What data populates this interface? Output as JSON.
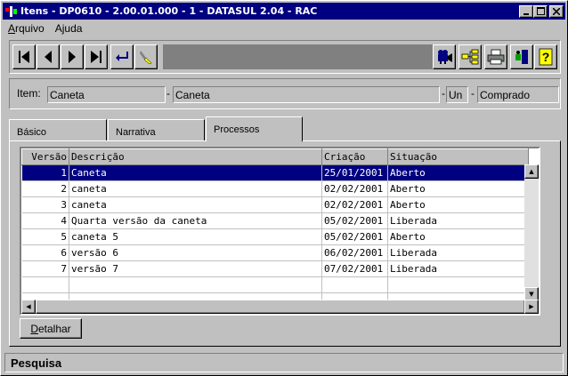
{
  "window": {
    "title": "Itens - DP0610 - 2.00.01.000 - 1 - DATASUL 2.04 - RAC",
    "icons": [
      "app-icon",
      "minimize-icon",
      "maximize-icon",
      "close-icon"
    ]
  },
  "menu": {
    "items": [
      {
        "label": "Arquivo",
        "accel": "A"
      },
      {
        "label": "Ajuda",
        "accel": "j"
      }
    ]
  },
  "toolbar": {
    "nav_buttons": [
      "first-icon",
      "prev-icon",
      "next-icon",
      "last-icon",
      "goto-icon",
      "search-icon"
    ],
    "right_buttons": [
      "camera-icon",
      "tree-icon",
      "printer-icon",
      "exit-icon",
      "help-icon"
    ]
  },
  "item": {
    "label": "Item:",
    "code": "Caneta",
    "description": "Caneta",
    "sep1": "-",
    "sep2": "-",
    "sep3": "-",
    "unit": "Un",
    "type": "Comprado"
  },
  "tabs": [
    {
      "label": "Básico",
      "active": false
    },
    {
      "label": "Narrativa",
      "active": false
    },
    {
      "label": "Processos",
      "active": true
    }
  ],
  "grid": {
    "columns": [
      "Versão",
      "Descrição",
      "Criação",
      "Situação"
    ],
    "rows": [
      {
        "versao": "1",
        "descricao": "Caneta",
        "criacao": "25/01/2001",
        "situacao": "Aberto",
        "selected": true
      },
      {
        "versao": "2",
        "descricao": "caneta",
        "criacao": "02/02/2001",
        "situacao": "Aberto",
        "selected": false
      },
      {
        "versao": "3",
        "descricao": "caneta",
        "criacao": "02/02/2001",
        "situacao": "Aberto",
        "selected": false
      },
      {
        "versao": "4",
        "descricao": "Quarta versão da caneta",
        "criacao": "05/02/2001",
        "situacao": "Liberada",
        "selected": false
      },
      {
        "versao": "5",
        "descricao": "caneta 5",
        "criacao": "05/02/2001",
        "situacao": "Aberto",
        "selected": false
      },
      {
        "versao": "6",
        "descricao": "versão 6",
        "criacao": "06/02/2001",
        "situacao": "Liberada",
        "selected": false
      },
      {
        "versao": "7",
        "descricao": "versão 7",
        "criacao": "07/02/2001",
        "situacao": "Liberada",
        "selected": false
      }
    ]
  },
  "buttons": {
    "detalhar": "Detalhar"
  },
  "status": {
    "text": "Pesquisa"
  },
  "colors": {
    "titlebar": "#000080",
    "face": "#c0c0c0",
    "selection": "#000080"
  }
}
